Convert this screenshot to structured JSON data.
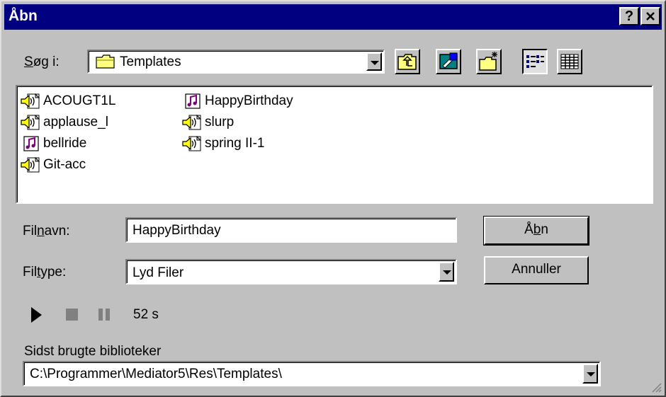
{
  "window": {
    "title": "Åbn",
    "help_button": "?",
    "close_button": "✕"
  },
  "lookin": {
    "label_prefix": "",
    "label_accel": "S",
    "label_rest": "øg i:",
    "value": "Templates",
    "icon": "folder-icon"
  },
  "toolbar": {
    "up_icon": "up-one-level-icon",
    "desktop_icon": "desktop-icon",
    "new_folder_icon": "new-folder-icon",
    "list_icon": "list-view-icon",
    "details_icon": "details-view-icon"
  },
  "files": [
    {
      "name": "ACOUGT1L",
      "type": "sound"
    },
    {
      "name": "applause_l",
      "type": "sound"
    },
    {
      "name": "bellride",
      "type": "midi"
    },
    {
      "name": "Git-acc",
      "type": "sound"
    },
    {
      "name": "HappyBirthday",
      "type": "midi"
    },
    {
      "name": "slurp",
      "type": "sound"
    },
    {
      "name": "spring II-1",
      "type": "sound"
    }
  ],
  "filename": {
    "label_prefix": "Fil",
    "label_accel": "n",
    "label_rest": "avn:",
    "value": "HappyBirthday"
  },
  "filetype": {
    "label_prefix": "Fil",
    "label_accel": "t",
    "label_rest": "ype:",
    "value": "Lyd Filer"
  },
  "buttons": {
    "open_prefix": "Å",
    "open_accel": "b",
    "open_rest": "n",
    "cancel": "Annuller"
  },
  "player": {
    "duration": "52 s"
  },
  "recent": {
    "label": "Sidst brugte biblioteker",
    "value": "C:\\Programmer\\Mediator5\\Res\\Templates\\"
  },
  "colors": {
    "titlebar": "#000080",
    "face": "#c0c0c0",
    "midi_note": "#800080",
    "speaker": "#c0c000"
  }
}
